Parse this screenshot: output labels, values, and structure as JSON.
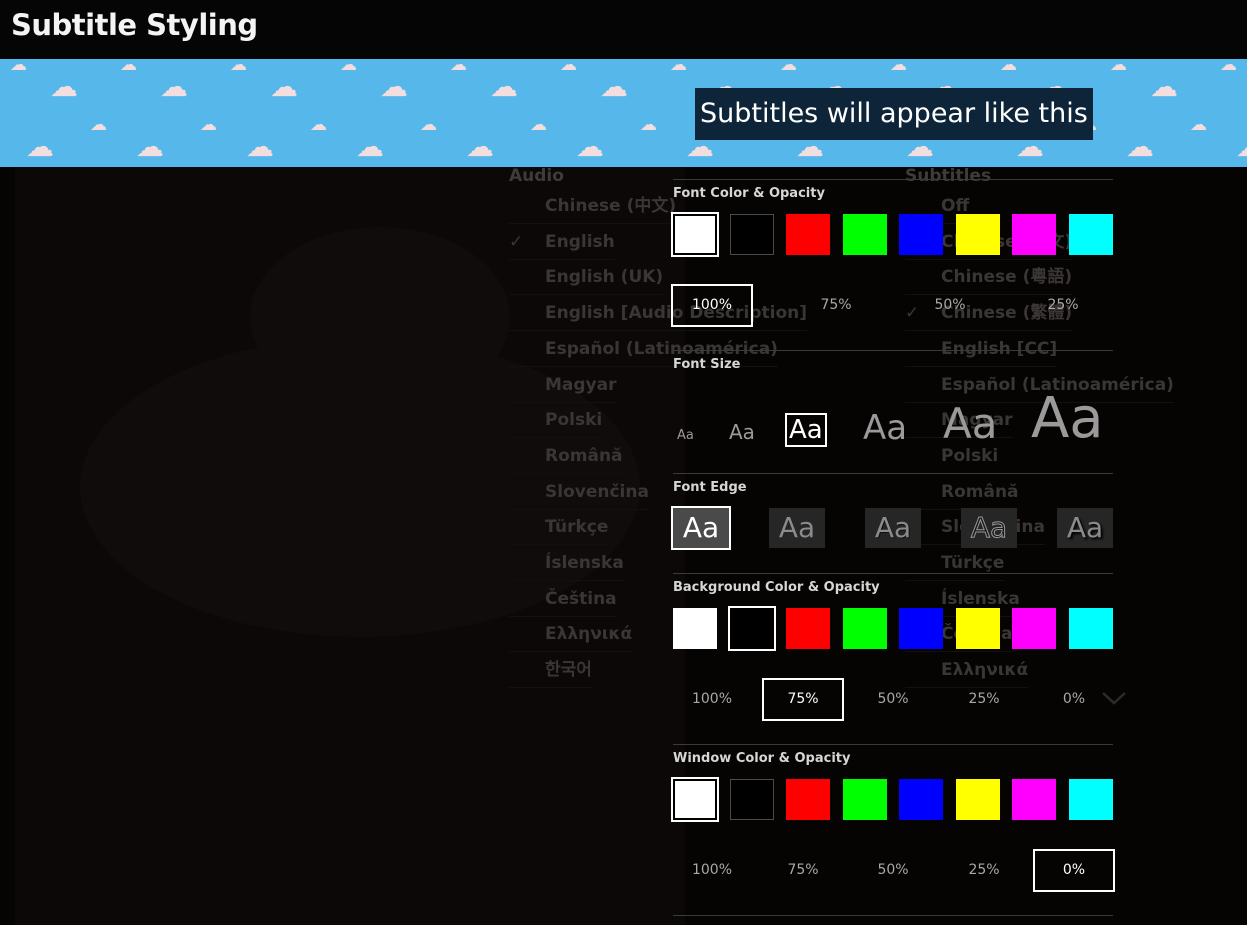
{
  "header": {
    "title": "Subtitle Styling"
  },
  "preview": {
    "text": "Subtitles will appear like this"
  },
  "background_menu": {
    "audio_heading": "Audio",
    "audio_items": [
      "Chinese (中文)",
      "English",
      "English (UK)",
      "English [Audio Description]",
      "Español (Latinoamérica)",
      "Magyar",
      "Polski",
      "Română",
      "Slovenčina",
      "Türkçe",
      "Íslenska",
      "Čeština",
      "Ελληνικά",
      "한국어"
    ],
    "audio_selected_mark": "✓",
    "subtitles_heading": "Subtitles",
    "subtitle_items": [
      "Off",
      "Chinese (中文)",
      "Chinese (粵語)",
      "Chinese (繁體)",
      "English [CC]",
      "Español (Latinoamérica)",
      "Magyar",
      "Polski",
      "Română",
      "Slovenčina",
      "Türkçe",
      "Íslenska",
      "Čeština",
      "Ελληνικά"
    ],
    "subtitle_selected_mark": "✓"
  },
  "font_color": {
    "title": "Font Color & Opacity",
    "swatches": [
      "#ffffff",
      "#000000",
      "#ff0000",
      "#00ff00",
      "#0000ff",
      "#ffff00",
      "#ff00ff",
      "#00ffff"
    ],
    "selected_swatch": 0,
    "opacity_options": [
      "100%",
      "75%",
      "50%",
      "25%"
    ],
    "selected_opacity": "100%"
  },
  "font_size": {
    "title": "Font Size",
    "options": [
      "Aa",
      "Aa",
      "Aa",
      "Aa",
      "Aa",
      "Aa"
    ],
    "selected_index": 2
  },
  "font_edge": {
    "title": "Font Edge",
    "options": [
      "Aa",
      "Aa",
      "Aa",
      "Aa",
      "Aa"
    ],
    "selected_index": 0
  },
  "background_color": {
    "title": "Background Color & Opacity",
    "swatches": [
      "#ffffff",
      "#000000",
      "#ff0000",
      "#00ff00",
      "#0000ff",
      "#ffff00",
      "#ff00ff",
      "#00ffff"
    ],
    "selected_swatch": 1,
    "opacity_options": [
      "100%",
      "75%",
      "50%",
      "25%",
      "0%"
    ],
    "selected_opacity": "75%"
  },
  "window_color": {
    "title": "Window Color & Opacity",
    "swatches": [
      "#ffffff",
      "#000000",
      "#ff0000",
      "#00ff00",
      "#0000ff",
      "#ffff00",
      "#ff00ff",
      "#00ffff"
    ],
    "selected_swatch": 0,
    "opacity_options": [
      "100%",
      "75%",
      "50%",
      "25%",
      "0%"
    ],
    "selected_opacity": "0%"
  }
}
